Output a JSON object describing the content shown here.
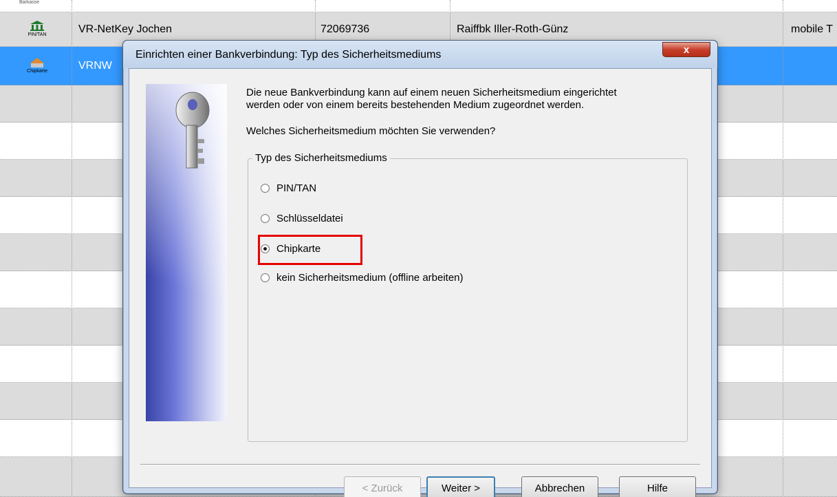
{
  "table": {
    "rows": [
      {
        "style": "white",
        "icon": null,
        "top_label": "Barkasse",
        "name": "",
        "code": "",
        "bank": "",
        "extra": ""
      },
      {
        "style": "gray",
        "icon": "bank-icon",
        "icon_label": "PIN/TAN",
        "icon_side": "HBCI",
        "name": "VR-NetKey Jochen",
        "code": "72069736",
        "bank": "Raiffbk Iller-Roth-Günz",
        "extra": "mobile T"
      },
      {
        "style": "sel",
        "icon": "chipcard-icon",
        "icon_label": "Chipkarte",
        "icon_side": "HBCI",
        "name": "VRNW",
        "code": "",
        "bank": "",
        "extra": ""
      }
    ]
  },
  "dialog": {
    "title": "Einrichten einer Bankverbindung: Typ des Sicherheitsmediums",
    "close_label": "x",
    "intro_line1": "Die neue Bankverbindung kann  auf einem neuen Sicherheitsmedium eingerichtet",
    "intro_line2": "werden oder von einem bereits bestehenden Medium zugeordnet werden.",
    "question": "Welches Sicherheitsmedium möchten Sie verwenden?",
    "group_label": "Typ des Sicherheitsmediums",
    "options": [
      {
        "label": "PIN/TAN",
        "checked": false
      },
      {
        "label": "Schlüsseldatei",
        "checked": false
      },
      {
        "label": "Chipkarte",
        "checked": true
      },
      {
        "label": "kein Sicherheitsmedium (offline arbeiten)",
        "checked": false
      }
    ],
    "buttons": {
      "back": "< Zurück",
      "next": "Weiter >",
      "cancel": "Abbrechen",
      "help": "Hilfe"
    }
  },
  "colors": {
    "selection": "#3399ff",
    "highlight": "#e60000"
  }
}
